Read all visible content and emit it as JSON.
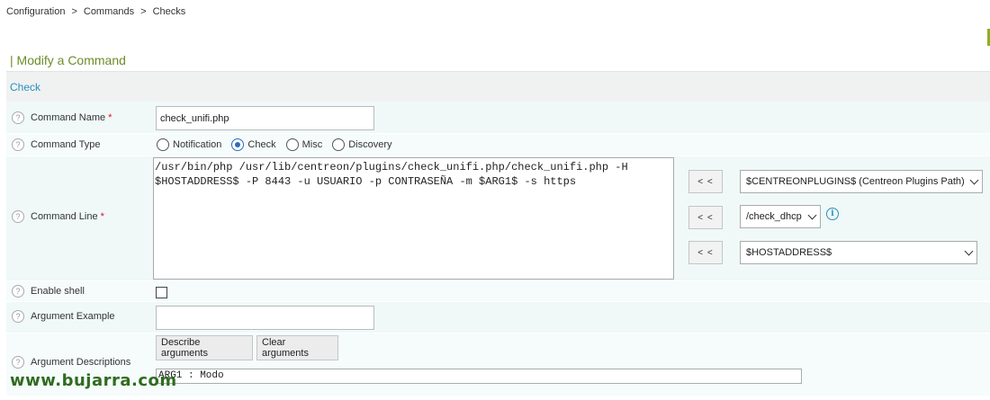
{
  "breadcrumb": {
    "items": [
      "Configuration",
      "Commands",
      "Checks"
    ],
    "separator": ">"
  },
  "page": {
    "title": "| Modify a Command"
  },
  "section": {
    "tab": "Check"
  },
  "form": {
    "command_name": {
      "label": "Command Name",
      "required_mark": "*",
      "value": "check_unifi.php"
    },
    "command_type": {
      "label": "Command Type",
      "options": [
        "Notification",
        "Check",
        "Misc",
        "Discovery"
      ],
      "selected": "Check"
    },
    "command_line": {
      "label": "Command Line",
      "required_mark": "*",
      "value": "/usr/bin/php /usr/lib/centreon/plugins/check_unifi.php/check_unifi.php -H\n$HOSTADDRESS$ -P 8443 -u USUARIO -p CONTRASEÑA -m $ARG1$ -s https",
      "insert_button_label": "< <",
      "macros_select": "$CENTREONPLUGINS$ (Centreon Plugins Path)",
      "plugin_select": "/check_dhcp",
      "host_select": "$HOSTADDRESS$"
    },
    "enable_shell": {
      "label": "Enable shell",
      "checked": false
    },
    "argument_example": {
      "label": "Argument Example",
      "value": ""
    },
    "argument_descriptions": {
      "label": "Argument Descriptions",
      "describe_button": "Describe arguments",
      "clear_button": "Clear arguments",
      "value": "ARG1 : Modo"
    }
  },
  "watermark": "www.bujarra.com",
  "colors": {
    "title": "#6d8c2a",
    "link": "#2a8fc1",
    "accent_bar": "#8cb020",
    "row_bg": "#f0f8f8",
    "required": "#dd1122"
  },
  "icons": {
    "help": "question-circle-icon",
    "info": "info-circle-icon",
    "dropdown": "chevron-down-icon"
  }
}
